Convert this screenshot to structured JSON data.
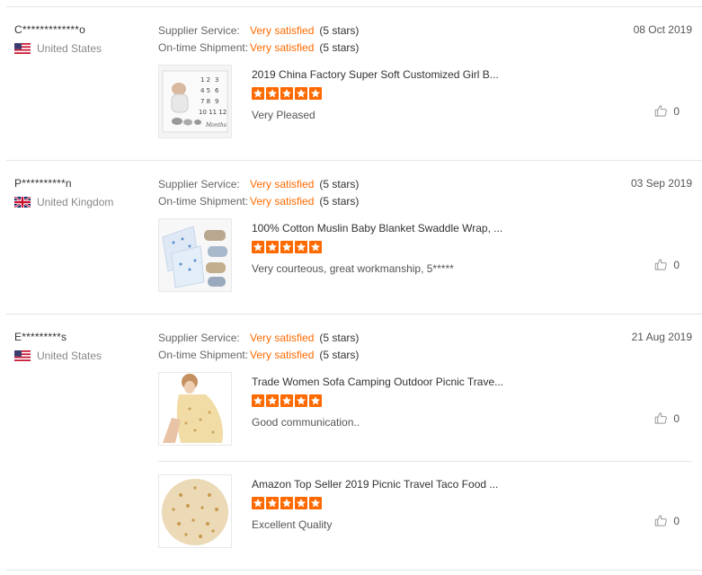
{
  "labels": {
    "supplier_service": "Supplier Service:",
    "ontime_shipment": "On-time Shipment:"
  },
  "colors": {
    "accent": "#ff6a00",
    "divider": "#e5e5e5"
  },
  "reviews": [
    {
      "buyer": "C*************o",
      "country": "United States",
      "flag": "us-flag-icon",
      "supplier_rating": "Very satisfied",
      "supplier_stars": "(5 stars)",
      "shipment_rating": "Very satisfied",
      "shipment_stars": "(5 stars)",
      "date": "08 Oct 2019",
      "products": [
        {
          "name": "2019 China Factory Super Soft Customized Girl B...",
          "stars": 5,
          "comment": "Very Pleased",
          "likes": "0"
        }
      ]
    },
    {
      "buyer": "P**********n",
      "country": "United Kingdom",
      "flag": "uk-flag-icon",
      "supplier_rating": "Very satisfied",
      "supplier_stars": "(5 stars)",
      "shipment_rating": "Very satisfied",
      "shipment_stars": "(5 stars)",
      "date": "03 Sep 2019",
      "products": [
        {
          "name": "100% Cotton Muslin Baby Blanket Swaddle Wrap, ...",
          "stars": 5,
          "comment": "Very courteous, great workmanship, 5*****",
          "likes": "0"
        }
      ]
    },
    {
      "buyer": "E*********s",
      "country": "United States",
      "flag": "us-flag-icon",
      "supplier_rating": "Very satisfied",
      "supplier_stars": "(5 stars)",
      "shipment_rating": "Very satisfied",
      "shipment_stars": "(5 stars)",
      "date": "21 Aug 2019",
      "products": [
        {
          "name": "Trade Women Sofa Camping Outdoor Picnic Trave...",
          "stars": 5,
          "comment": "Good communication..",
          "likes": "0"
        },
        {
          "name": "Amazon Top Seller 2019 Picnic Travel Taco Food ...",
          "stars": 5,
          "comment": "Excellent Quality",
          "likes": "0"
        }
      ]
    }
  ]
}
